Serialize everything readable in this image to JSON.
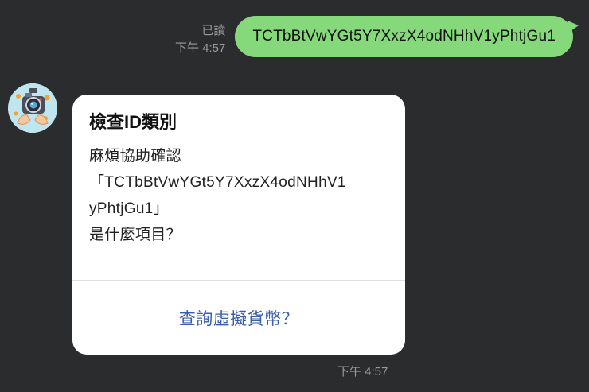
{
  "outgoing": {
    "read_status": "已讀",
    "time": "下午 4:57",
    "text": "TCTbBtVwYGt5Y7XxzX4odNHhV1yPhtjGu1"
  },
  "incoming": {
    "avatar_icon": "camera-cartoon-icon",
    "card": {
      "title": "檢查ID類別",
      "lines": [
        "麻煩協助確認",
        "「TCTbBtVwYGt5Y7XxzX4odNHhV1",
        "yPhtjGu1」",
        "是什麼項目？"
      ],
      "action_label": "查詢虛擬貨幣？"
    },
    "time": "下午 4:57"
  },
  "colors": {
    "background": "#2b2c2e",
    "outgoing_bubble": "#86d97a",
    "card_background": "#ffffff",
    "action_link": "#3b5ea8",
    "meta_text": "#9a9a9a"
  }
}
